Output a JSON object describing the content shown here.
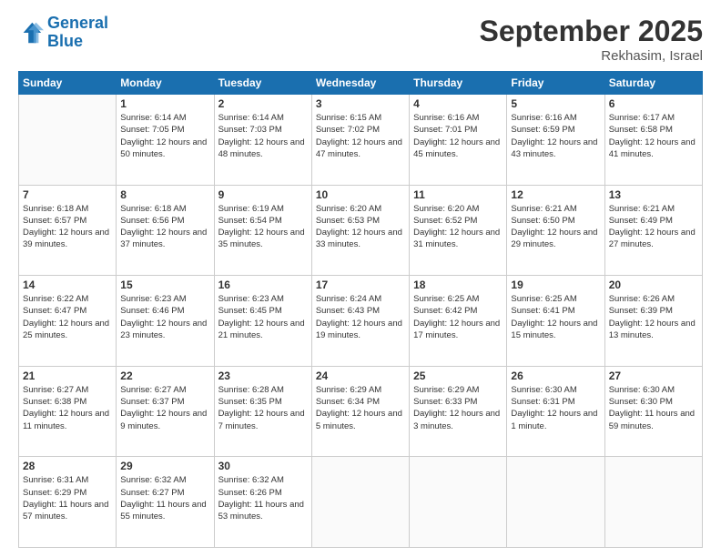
{
  "logo": {
    "line1": "General",
    "line2": "Blue"
  },
  "header": {
    "title": "September 2025",
    "location": "Rekhasim, Israel"
  },
  "days_of_week": [
    "Sunday",
    "Monday",
    "Tuesday",
    "Wednesday",
    "Thursday",
    "Friday",
    "Saturday"
  ],
  "weeks": [
    [
      {
        "day": "",
        "sunrise": "",
        "sunset": "",
        "daylight": ""
      },
      {
        "day": "1",
        "sunrise": "Sunrise: 6:14 AM",
        "sunset": "Sunset: 7:05 PM",
        "daylight": "Daylight: 12 hours and 50 minutes."
      },
      {
        "day": "2",
        "sunrise": "Sunrise: 6:14 AM",
        "sunset": "Sunset: 7:03 PM",
        "daylight": "Daylight: 12 hours and 48 minutes."
      },
      {
        "day": "3",
        "sunrise": "Sunrise: 6:15 AM",
        "sunset": "Sunset: 7:02 PM",
        "daylight": "Daylight: 12 hours and 47 minutes."
      },
      {
        "day": "4",
        "sunrise": "Sunrise: 6:16 AM",
        "sunset": "Sunset: 7:01 PM",
        "daylight": "Daylight: 12 hours and 45 minutes."
      },
      {
        "day": "5",
        "sunrise": "Sunrise: 6:16 AM",
        "sunset": "Sunset: 6:59 PM",
        "daylight": "Daylight: 12 hours and 43 minutes."
      },
      {
        "day": "6",
        "sunrise": "Sunrise: 6:17 AM",
        "sunset": "Sunset: 6:58 PM",
        "daylight": "Daylight: 12 hours and 41 minutes."
      }
    ],
    [
      {
        "day": "7",
        "sunrise": "Sunrise: 6:18 AM",
        "sunset": "Sunset: 6:57 PM",
        "daylight": "Daylight: 12 hours and 39 minutes."
      },
      {
        "day": "8",
        "sunrise": "Sunrise: 6:18 AM",
        "sunset": "Sunset: 6:56 PM",
        "daylight": "Daylight: 12 hours and 37 minutes."
      },
      {
        "day": "9",
        "sunrise": "Sunrise: 6:19 AM",
        "sunset": "Sunset: 6:54 PM",
        "daylight": "Daylight: 12 hours and 35 minutes."
      },
      {
        "day": "10",
        "sunrise": "Sunrise: 6:20 AM",
        "sunset": "Sunset: 6:53 PM",
        "daylight": "Daylight: 12 hours and 33 minutes."
      },
      {
        "day": "11",
        "sunrise": "Sunrise: 6:20 AM",
        "sunset": "Sunset: 6:52 PM",
        "daylight": "Daylight: 12 hours and 31 minutes."
      },
      {
        "day": "12",
        "sunrise": "Sunrise: 6:21 AM",
        "sunset": "Sunset: 6:50 PM",
        "daylight": "Daylight: 12 hours and 29 minutes."
      },
      {
        "day": "13",
        "sunrise": "Sunrise: 6:21 AM",
        "sunset": "Sunset: 6:49 PM",
        "daylight": "Daylight: 12 hours and 27 minutes."
      }
    ],
    [
      {
        "day": "14",
        "sunrise": "Sunrise: 6:22 AM",
        "sunset": "Sunset: 6:47 PM",
        "daylight": "Daylight: 12 hours and 25 minutes."
      },
      {
        "day": "15",
        "sunrise": "Sunrise: 6:23 AM",
        "sunset": "Sunset: 6:46 PM",
        "daylight": "Daylight: 12 hours and 23 minutes."
      },
      {
        "day": "16",
        "sunrise": "Sunrise: 6:23 AM",
        "sunset": "Sunset: 6:45 PM",
        "daylight": "Daylight: 12 hours and 21 minutes."
      },
      {
        "day": "17",
        "sunrise": "Sunrise: 6:24 AM",
        "sunset": "Sunset: 6:43 PM",
        "daylight": "Daylight: 12 hours and 19 minutes."
      },
      {
        "day": "18",
        "sunrise": "Sunrise: 6:25 AM",
        "sunset": "Sunset: 6:42 PM",
        "daylight": "Daylight: 12 hours and 17 minutes."
      },
      {
        "day": "19",
        "sunrise": "Sunrise: 6:25 AM",
        "sunset": "Sunset: 6:41 PM",
        "daylight": "Daylight: 12 hours and 15 minutes."
      },
      {
        "day": "20",
        "sunrise": "Sunrise: 6:26 AM",
        "sunset": "Sunset: 6:39 PM",
        "daylight": "Daylight: 12 hours and 13 minutes."
      }
    ],
    [
      {
        "day": "21",
        "sunrise": "Sunrise: 6:27 AM",
        "sunset": "Sunset: 6:38 PM",
        "daylight": "Daylight: 12 hours and 11 minutes."
      },
      {
        "day": "22",
        "sunrise": "Sunrise: 6:27 AM",
        "sunset": "Sunset: 6:37 PM",
        "daylight": "Daylight: 12 hours and 9 minutes."
      },
      {
        "day": "23",
        "sunrise": "Sunrise: 6:28 AM",
        "sunset": "Sunset: 6:35 PM",
        "daylight": "Daylight: 12 hours and 7 minutes."
      },
      {
        "day": "24",
        "sunrise": "Sunrise: 6:29 AM",
        "sunset": "Sunset: 6:34 PM",
        "daylight": "Daylight: 12 hours and 5 minutes."
      },
      {
        "day": "25",
        "sunrise": "Sunrise: 6:29 AM",
        "sunset": "Sunset: 6:33 PM",
        "daylight": "Daylight: 12 hours and 3 minutes."
      },
      {
        "day": "26",
        "sunrise": "Sunrise: 6:30 AM",
        "sunset": "Sunset: 6:31 PM",
        "daylight": "Daylight: 12 hours and 1 minute."
      },
      {
        "day": "27",
        "sunrise": "Sunrise: 6:30 AM",
        "sunset": "Sunset: 6:30 PM",
        "daylight": "Daylight: 11 hours and 59 minutes."
      }
    ],
    [
      {
        "day": "28",
        "sunrise": "Sunrise: 6:31 AM",
        "sunset": "Sunset: 6:29 PM",
        "daylight": "Daylight: 11 hours and 57 minutes."
      },
      {
        "day": "29",
        "sunrise": "Sunrise: 6:32 AM",
        "sunset": "Sunset: 6:27 PM",
        "daylight": "Daylight: 11 hours and 55 minutes."
      },
      {
        "day": "30",
        "sunrise": "Sunrise: 6:32 AM",
        "sunset": "Sunset: 6:26 PM",
        "daylight": "Daylight: 11 hours and 53 minutes."
      },
      {
        "day": "",
        "sunrise": "",
        "sunset": "",
        "daylight": ""
      },
      {
        "day": "",
        "sunrise": "",
        "sunset": "",
        "daylight": ""
      },
      {
        "day": "",
        "sunrise": "",
        "sunset": "",
        "daylight": ""
      },
      {
        "day": "",
        "sunrise": "",
        "sunset": "",
        "daylight": ""
      }
    ]
  ]
}
